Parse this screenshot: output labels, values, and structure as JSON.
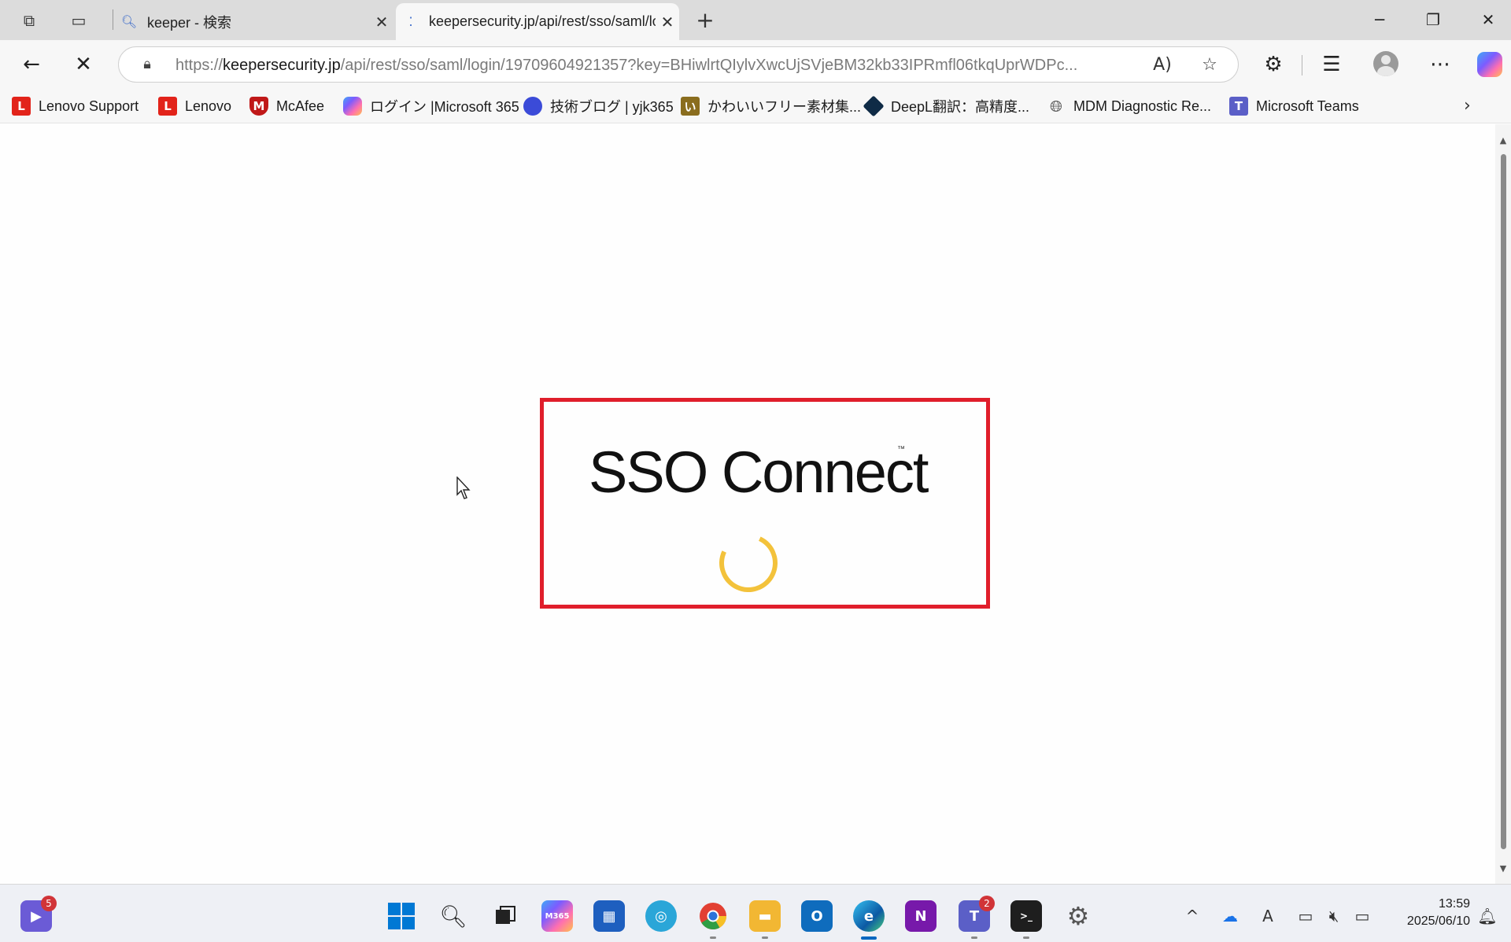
{
  "tabs": [
    {
      "title": "keeper - 検索",
      "favicon": "search-icon"
    },
    {
      "title": "keepersecurity.jp/api/rest/sso/saml/login",
      "favicon": "loading-dots-icon"
    }
  ],
  "address_bar": {
    "url_scheme": "https://",
    "url_host": "keepersecurity.jp",
    "url_path": "/api/rest/sso/saml/login/19709604921357?key=BHiwlrtQIylvXwcUjSVjeBM32kb33IPRmfl06tkqUprWDPc..."
  },
  "favorites": [
    {
      "label": "Lenovo Support",
      "icon": "lenovo-icon",
      "color": "#e2231a"
    },
    {
      "label": "Lenovo",
      "icon": "lenovo-icon",
      "color": "#e2231a"
    },
    {
      "label": "McAfee",
      "icon": "mcafee-shield-icon",
      "color": "#c01818"
    },
    {
      "label": "ログイン |Microsoft 365",
      "icon": "microsoft365-icon",
      "color": "#7f5af0"
    },
    {
      "label": "技術ブログ | yjk365",
      "icon": "blog-icon",
      "color": "#3b4bd8"
    },
    {
      "label": "かわいいフリー素材集...",
      "icon": "irasutoya-icon",
      "color": "#8a6d1e"
    },
    {
      "label": "DeepL翻訳：高精度...",
      "icon": "deepl-icon",
      "color": "#0f2b46"
    },
    {
      "label": "MDM Diagnostic Re...",
      "icon": "globe-icon",
      "color": "#555555"
    },
    {
      "label": "Microsoft Teams",
      "icon": "teams-icon",
      "color": "#5b5fc7"
    }
  ],
  "page": {
    "title": "SSO Connect",
    "trademark": "™",
    "spinner_color": "#f3c23b",
    "highlight_color": "#e01e2b"
  },
  "taskbar": {
    "notification_badge": "5",
    "teams_badge": "2",
    "time": "13:59",
    "date": "2025/06/10"
  }
}
